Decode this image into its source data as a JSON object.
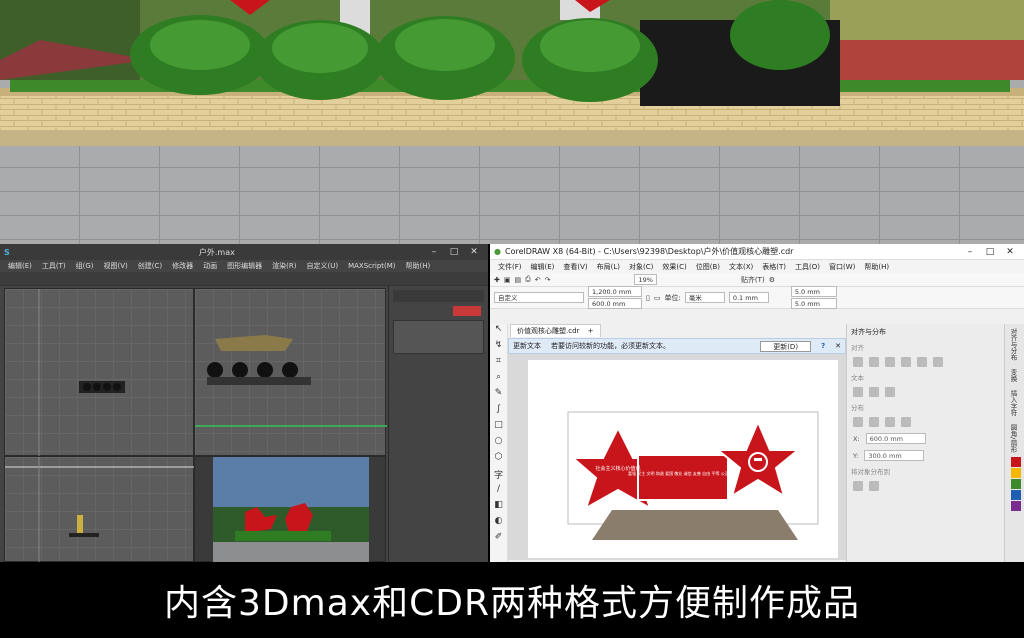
{
  "max_window": {
    "title": "户外.max",
    "menu": [
      "编辑(E)",
      "工具(T)",
      "组(G)",
      "视图(V)",
      "创建(C)",
      "修改器",
      "动画",
      "图形编辑器",
      "渲染(R)",
      "自定义(U)",
      "MAXScript(M)",
      "帮助(H)"
    ]
  },
  "cdr_window": {
    "title": "CorelDRAW X8 (64-Bit) - C:\\Users\\92398\\Desktop\\户外\\价值观核心雕塑.cdr",
    "menu": [
      "文件(F)",
      "编辑(E)",
      "查看(V)",
      "布局(L)",
      "对象(C)",
      "效果(C)",
      "位图(B)",
      "文本(X)",
      "表格(T)",
      "工具(O)",
      "窗口(W)",
      "帮助(H)"
    ],
    "zoom": "19%",
    "preset": "自定义",
    "width": "1,200.0 mm",
    "height": "600.0 mm",
    "unit_label": "单位:",
    "unit": "毫米",
    "nudge": "0.1 mm",
    "dup_x": "5.0 mm",
    "dup_y": "5.0 mm",
    "snap": "贴齐(T)",
    "doc_tab": "价值观核心雕塑.cdr",
    "notice_title": "更新文本",
    "notice_text": "若要访问较新的功能，必须更新文本。",
    "notice_button": "更新(D)",
    "docker_title": "对齐与分布",
    "docker_align": "对齐",
    "docker_text": "文本",
    "docker_distribute": "分布",
    "docker_spacing": "将对象分布到",
    "docker_x": "600.0 mm",
    "docker_y": "300.0 mm",
    "side_tabs": [
      "对齐与分布",
      "变换",
      "插入字符",
      "圆角/扇形"
    ],
    "sculpture_left_text": "社会主义核心价值观",
    "sculpture_mid_text": "富强 民主 文明 和谐 爱国 敬业 诚信 友善 自由 平等 公正 法治"
  },
  "caption": "内含3Dmax和CDR两种格式方便制作成品",
  "colors": {
    "accent_red": "#c8151b",
    "brick": "#e6d19c",
    "grass": "#3e8a2a"
  }
}
